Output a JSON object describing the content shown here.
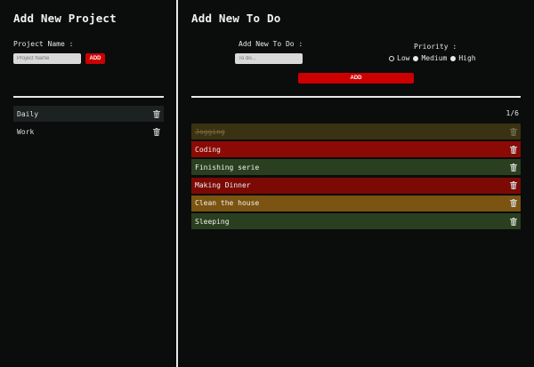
{
  "projects_panel": {
    "title": "Add New Project",
    "name_label": "Project Name :",
    "name_placeholder": "Project Name",
    "add_label": "ADD",
    "items": [
      {
        "label": "Daily",
        "active": true
      },
      {
        "label": "Work",
        "active": false
      }
    ]
  },
  "todo_panel": {
    "title": "Add New To Do",
    "todo_label": "Add New To Do :",
    "todo_placeholder": "To do...",
    "priority_label": "Priority :",
    "priorities": [
      {
        "label": "Low",
        "checked": true
      },
      {
        "label": "Medium",
        "checked": false
      },
      {
        "label": "High",
        "checked": false
      }
    ],
    "add_label": "ADD",
    "counter": "1/6",
    "items": [
      {
        "label": "Jogging",
        "color": "#3a3212",
        "done": true
      },
      {
        "label": "Coding",
        "color": "#8b0a05",
        "done": false
      },
      {
        "label": "Finishing serie",
        "color": "#2a3f1f",
        "done": false
      },
      {
        "label": "Making Dinner",
        "color": "#7b0a05",
        "done": false
      },
      {
        "label": "Clean the house",
        "color": "#7a5410",
        "done": false
      },
      {
        "label": "Sleeping",
        "color": "#2a3f1f",
        "done": false
      }
    ]
  },
  "colors": {
    "background": "#0b0c0c",
    "accent": "#cc0000",
    "divider": "#e8e8e8"
  }
}
